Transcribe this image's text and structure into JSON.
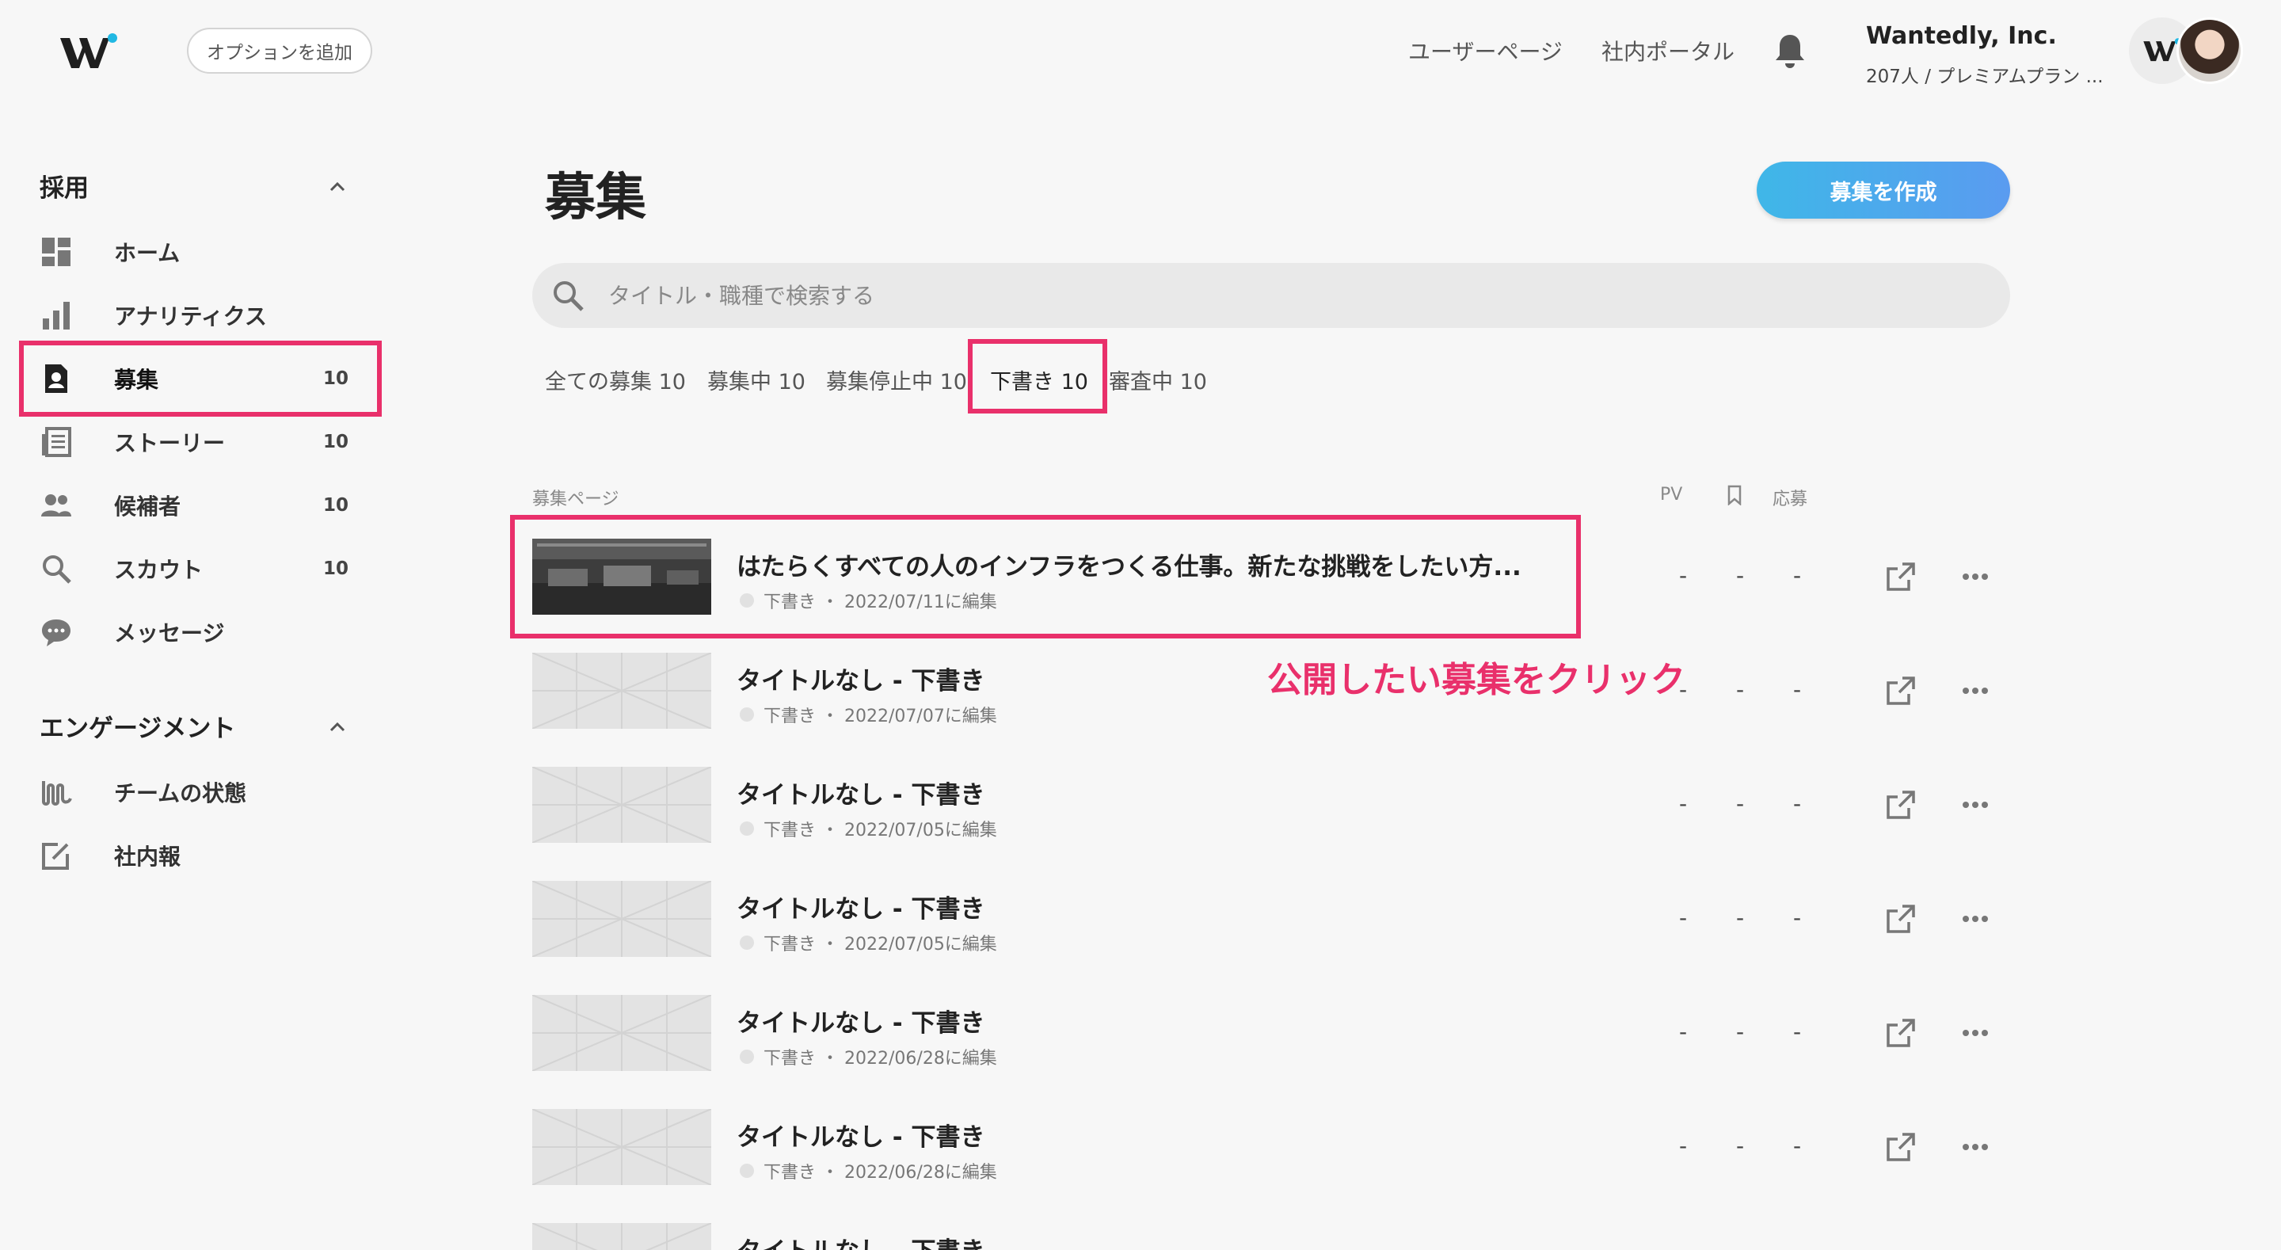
{
  "header": {
    "add_option": "オプションを追加",
    "links": [
      "ユーザーページ",
      "社内ポータル"
    ],
    "company_name": "Wantedly, Inc.",
    "company_plan": "207人 / プレミアムプラン ..."
  },
  "sidebar": {
    "recruit_title": "採用",
    "recruit_items": [
      {
        "label": "ホーム",
        "count": ""
      },
      {
        "label": "アナリティクス",
        "count": ""
      },
      {
        "label": "募集",
        "count": "10"
      },
      {
        "label": "ストーリー",
        "count": "10"
      },
      {
        "label": "候補者",
        "count": "10"
      },
      {
        "label": "スカウト",
        "count": "10"
      },
      {
        "label": "メッセージ",
        "count": ""
      }
    ],
    "engagement_title": "エンゲージメント",
    "engagement_items": [
      {
        "label": "チームの状態"
      },
      {
        "label": "社内報"
      }
    ]
  },
  "main": {
    "title": "募集",
    "create_button": "募集を作成",
    "search_placeholder": "タイトル・職種で検索する",
    "tabs": [
      "全ての募集 10",
      "募集中 10",
      "募集停止中 10",
      "下書き 10",
      "審査中 10"
    ],
    "active_tab": "下書き 10",
    "columns": {
      "page": "募集ページ",
      "pv": "PV",
      "apply": "応募"
    },
    "rows": [
      {
        "title": "はたらくすべての人のインフラをつくる仕事。新たな挑戦をしたい方...",
        "status": "下書き",
        "edited": "・ 2022/07/11に編集",
        "pv": "-",
        "bookmark": "-",
        "apply": "-"
      },
      {
        "title": "タイトルなし - 下書き",
        "status": "下書き",
        "edited": "・ 2022/07/07に編集",
        "pv": "-",
        "bookmark": "-",
        "apply": "-"
      },
      {
        "title": "タイトルなし - 下書き",
        "status": "下書き",
        "edited": "・ 2022/07/05に編集",
        "pv": "-",
        "bookmark": "-",
        "apply": "-"
      },
      {
        "title": "タイトルなし - 下書き",
        "status": "下書き",
        "edited": "・ 2022/07/05に編集",
        "pv": "-",
        "bookmark": "-",
        "apply": "-"
      },
      {
        "title": "タイトルなし - 下書き",
        "status": "下書き",
        "edited": "・ 2022/06/28に編集",
        "pv": "-",
        "bookmark": "-",
        "apply": "-"
      },
      {
        "title": "タイトルなし - 下書き",
        "status": "下書き",
        "edited": "・ 2022/06/28に編集",
        "pv": "-",
        "bookmark": "-",
        "apply": "-"
      },
      {
        "title": "タイトルなし - 下書き",
        "status": "",
        "edited": "",
        "pv": "",
        "bookmark": "",
        "apply": ""
      }
    ],
    "annotation": "公開したい募集をクリック"
  },
  "colors": {
    "accent": "#e9306b",
    "button_start": "#3fb7e8",
    "button_end": "#5a9bf0",
    "brand_dot": "#21b8e3"
  }
}
